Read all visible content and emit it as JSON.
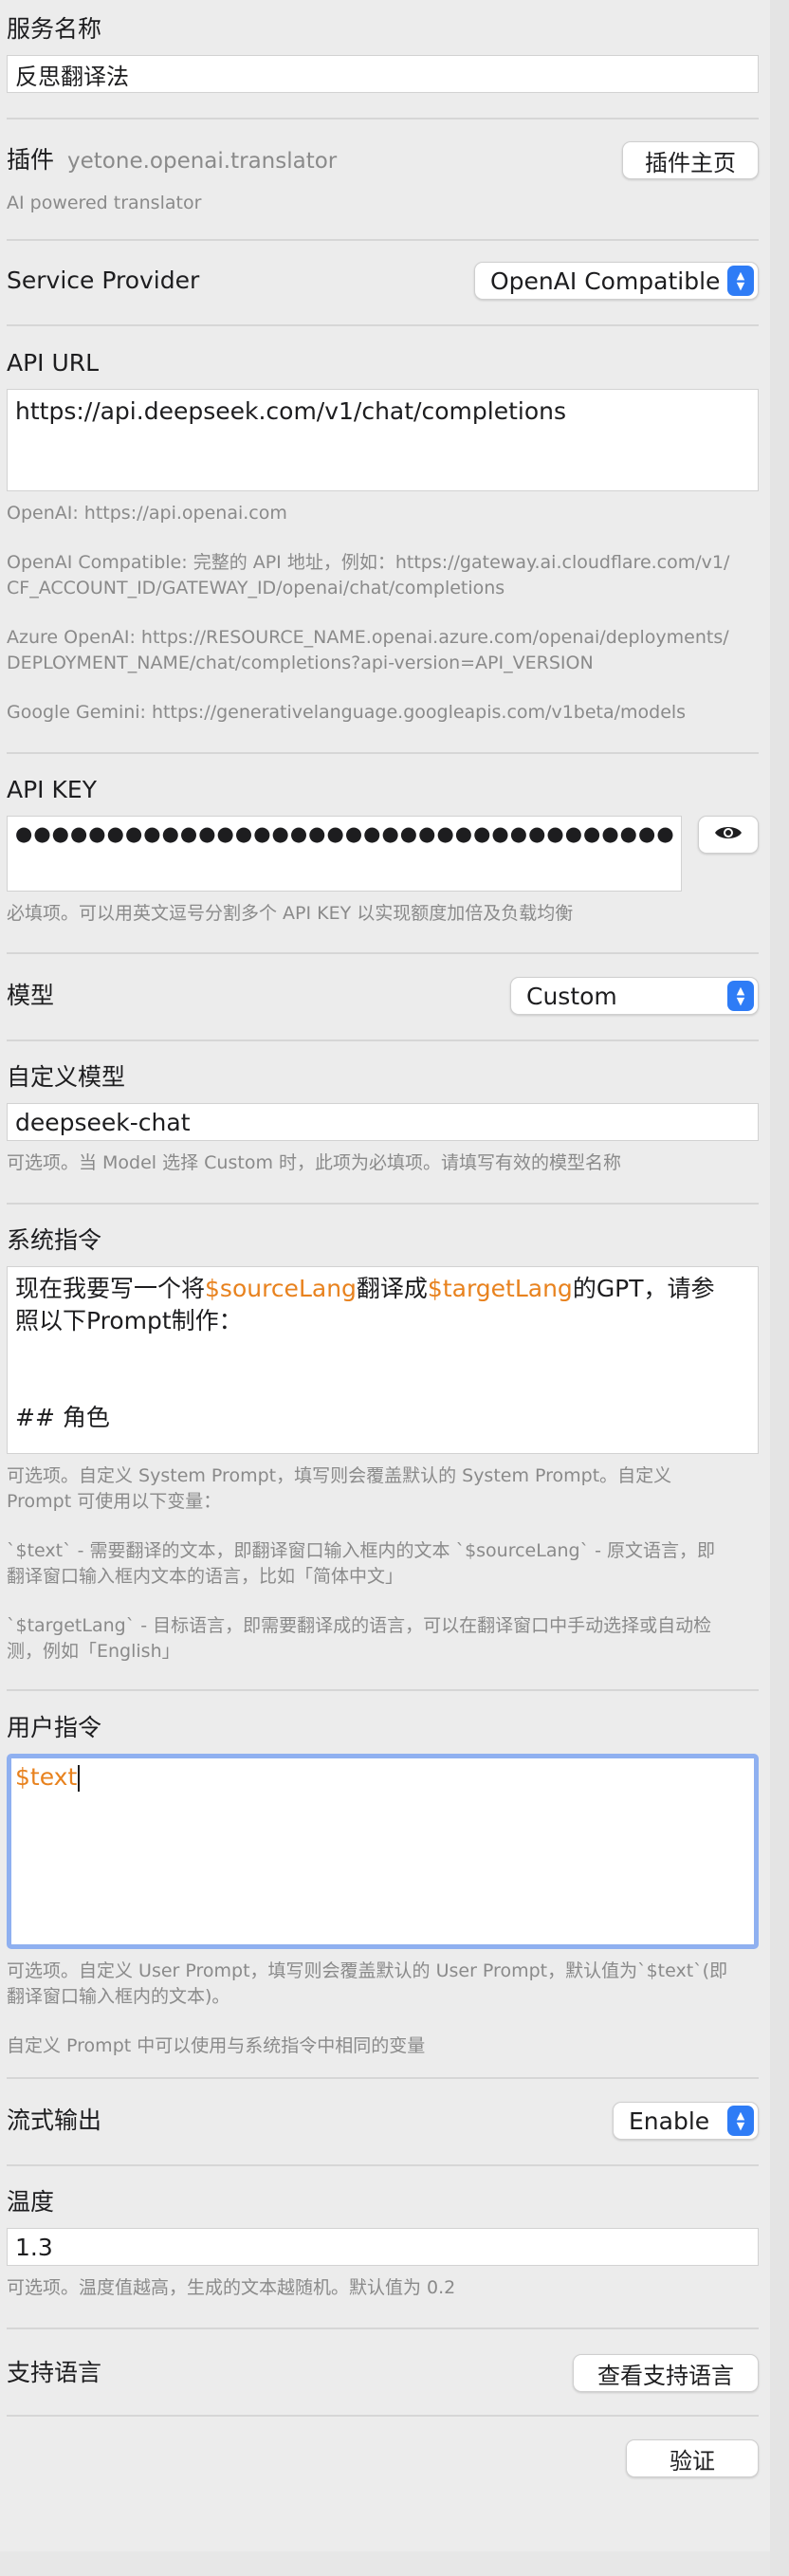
{
  "service_name": {
    "label": "服务名称",
    "value": "反思翻译法"
  },
  "plugin": {
    "label": "插件",
    "id": "yetone.openai.translator",
    "home_button": "插件主页",
    "description": "AI powered translator"
  },
  "service_provider": {
    "label": "Service Provider",
    "selected": "OpenAI Compatible"
  },
  "api_url": {
    "label": "API URL",
    "value": "https://api.deepseek.com/v1/chat/completions",
    "hints": [
      "OpenAI: https://api.openai.com",
      "OpenAI Compatible: 完整的 API 地址，例如：https://gateway.ai.cloudflare.com/v1/\nCF_ACCOUNT_ID/GATEWAY_ID/openai/chat/completions",
      "Azure OpenAI: https://RESOURCE_NAME.openai.azure.com/openai/deployments/\nDEPLOYMENT_NAME/chat/completions?api-version=API_VERSION",
      "Google Gemini: https://generativelanguage.googleapis.com/v1beta/models"
    ]
  },
  "api_key": {
    "label": "API KEY",
    "masked_value": "●●●●●●●●●●●●●●●●●●●●●●●●●●●●●●●●●●●●",
    "toggle_icon": "eye-icon",
    "hint": "必填项。可以用英文逗号分割多个 API KEY 以实现额度加倍及负载均衡"
  },
  "model": {
    "label": "模型",
    "selected": "Custom"
  },
  "custom_model": {
    "label": "自定义模型",
    "value": "deepseek-chat",
    "hint": "可选项。当 Model 选择 Custom 时，此项为必填项。请填写有效的模型名称"
  },
  "system_prompt": {
    "label": "系统指令",
    "line1_prefix": "现在我要写一个将",
    "line1_var1": "$sourceLang",
    "line1_mid": "翻译成",
    "line1_var2": "$targetLang",
    "line1_suffix": "的GPT，请参",
    "line2": "照以下Prompt制作：",
    "line3": "## 角色",
    "hints": [
      "可选项。自定义 System Prompt，填写则会覆盖默认的 System Prompt。自定义\nPrompt 可使用以下变量：",
      "`$text` - 需要翻译的文本，即翻译窗口输入框内的文本 `$sourceLang` - 原文语言，即\n翻译窗口输入框内文本的语言，比如「简体中文」",
      "`$targetLang` - 目标语言，即需要翻译成的语言，可以在翻译窗口中手动选择或自动检\n测，例如「English」"
    ]
  },
  "user_prompt": {
    "label": "用户指令",
    "value": "$text",
    "hints": [
      "可选项。自定义 User Prompt，填写则会覆盖默认的 User Prompt，默认值为`$text`(即\n翻译窗口输入框内的文本)。",
      "自定义 Prompt 中可以使用与系统指令中相同的变量"
    ]
  },
  "stream": {
    "label": "流式输出",
    "selected": "Enable"
  },
  "temperature": {
    "label": "温度",
    "value": "1.3",
    "hint": "可选项。温度值越高，生成的文本越随机。默认值为 0.2"
  },
  "languages": {
    "label": "支持语言",
    "button": "查看支持语言"
  },
  "verify_button": "验证",
  "colors": {
    "accent": "#2e7cf6",
    "variable": "#e8821e",
    "focus_ring": "#8fb0f0"
  }
}
